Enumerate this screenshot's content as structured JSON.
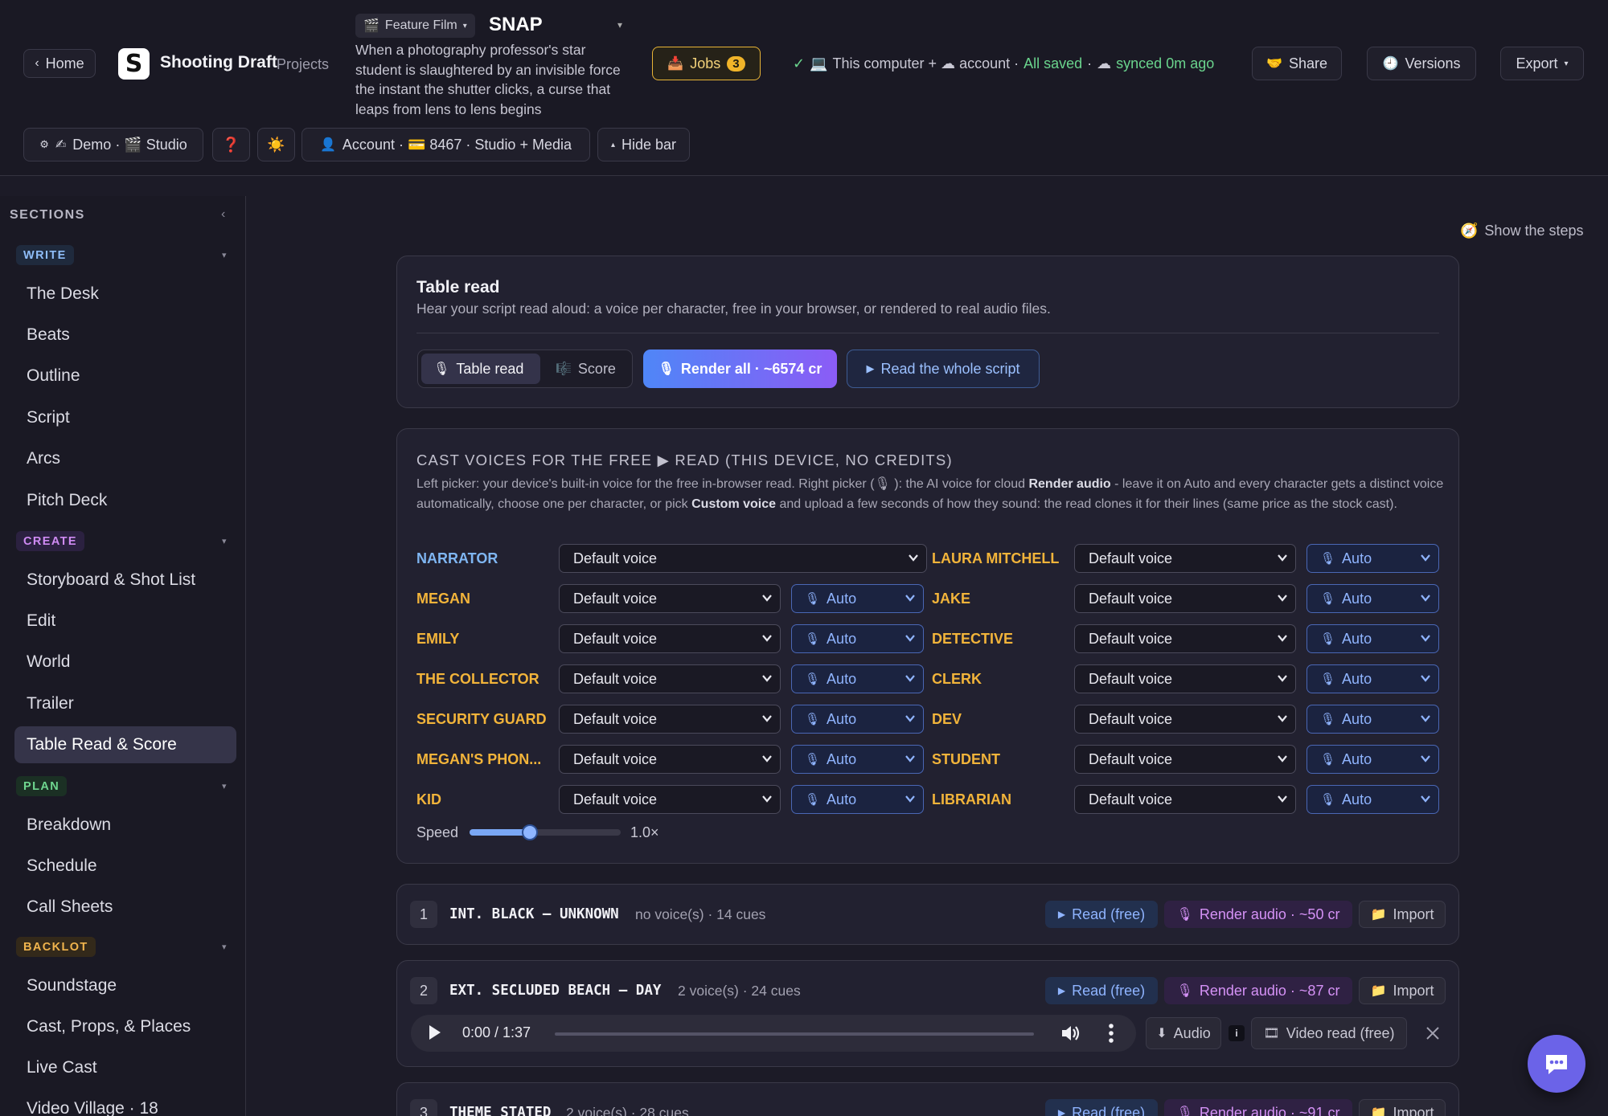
{
  "header": {
    "home_label": "Home",
    "app_name": "Shooting Draft",
    "projects_label": "Projects",
    "film_type": "Feature Film",
    "film_title": "SNAP",
    "logline": "When a photography professor's star student is slaughtered by an invisible force the instant the shutter clicks, a curse that leaps from lens to lens begins",
    "jobs_label": "Jobs",
    "jobs_count": "3",
    "sync_location": "This computer + ☁ account ·",
    "sync_saved": "All saved",
    "sync_dot": "·",
    "sync_time": "synced 0m ago",
    "share_label": "Share",
    "versions_label": "Versions",
    "export_label": "Export",
    "mode_label": "Demo · 🎬 Studio",
    "help_icon_text": "❓",
    "theme_icon_text": "☀️",
    "account_label": "Account · 💳 8467 · Studio + Media",
    "hide_bar_label": "Hide bar"
  },
  "sidebar": {
    "title": "SECTIONS",
    "groups": [
      {
        "label": "WRITE",
        "items": [
          "The Desk",
          "Beats",
          "Outline",
          "Script",
          "Arcs",
          "Pitch Deck"
        ]
      },
      {
        "label": "CREATE",
        "items": [
          "Storyboard & Shot List",
          "Edit",
          "World",
          "Trailer",
          "Table Read & Score"
        ]
      },
      {
        "label": "PLAN",
        "items": [
          "Breakdown",
          "Schedule",
          "Call Sheets"
        ]
      },
      {
        "label": "BACKLOT",
        "items": [
          "Soundstage",
          "Cast, Props, & Places",
          "Live Cast",
          "Video Village · 18"
        ]
      }
    ],
    "active_item": "Table Read & Score"
  },
  "show_steps_label": "Show the steps",
  "table_read": {
    "title": "Table read",
    "subtitle": "Hear your script read aloud: a voice per character, free in your browser, or rendered to real audio files.",
    "tab_table_read": "Table read",
    "tab_score": "Score",
    "render_all_label": "Render all · ~6574 cr",
    "read_whole_label": "Read the whole script"
  },
  "cast": {
    "heading": "CAST VOICES FOR THE FREE ▶ READ (THIS DEVICE, NO CREDITS)",
    "help_1": "Left picker: your device's built-in voice for the free in-browser read. Right picker (🎙 ): the AI voice for cloud ",
    "help_bold_1": "Render audio",
    "help_2": " - leave it on Auto and every character gets a distinct voice automatically, choose one per character, or pick ",
    "help_bold_2": "Custom voice",
    "help_3": " and upload a few seconds of how they sound: the read clones it for their lines (same price as the stock cast).",
    "default_voice": "Default voice",
    "auto_voice": "Auto",
    "left_column": [
      "NARRATOR",
      "MEGAN",
      "EMILY",
      "THE COLLECTOR",
      "SECURITY GUARD",
      "MEGAN'S PHON...",
      "KID"
    ],
    "right_column": [
      "LAURA MITCHELL",
      "JAKE",
      "DETECTIVE",
      "CLERK",
      "DEV",
      "STUDENT",
      "LIBRARIAN"
    ],
    "speed_label": "Speed",
    "speed_value": "1.0×",
    "speed_fraction": 0.4
  },
  "scenes": [
    {
      "num": "1",
      "title": "INT. BLACK – UNKNOWN",
      "meta": "no voice(s) · 14 cues",
      "read": "Read (free)",
      "render": "Render audio · ~50 cr",
      "import": "Import"
    },
    {
      "num": "2",
      "title": "EXT. SECLUDED BEACH – DAY",
      "meta": "2 voice(s) · 24 cues",
      "read": "Read (free)",
      "render": "Render audio · ~87 cr",
      "import": "Import",
      "player": {
        "time": "0:00 / 1:37",
        "audio_label": "Audio",
        "info_label": "i",
        "video_label": "Video read (free)"
      }
    },
    {
      "num": "3",
      "title": "THEME STATED",
      "meta": "2 voice(s) · 28 cues",
      "read": "Read (free)",
      "render": "Render audio · ~91 cr",
      "import": "Import"
    }
  ],
  "colors": {
    "accent": "#4f86f7",
    "character": "#f2b43a",
    "narrator": "#7fb6f2",
    "saved": "#6ad48d",
    "jobs": "#f0b429"
  }
}
